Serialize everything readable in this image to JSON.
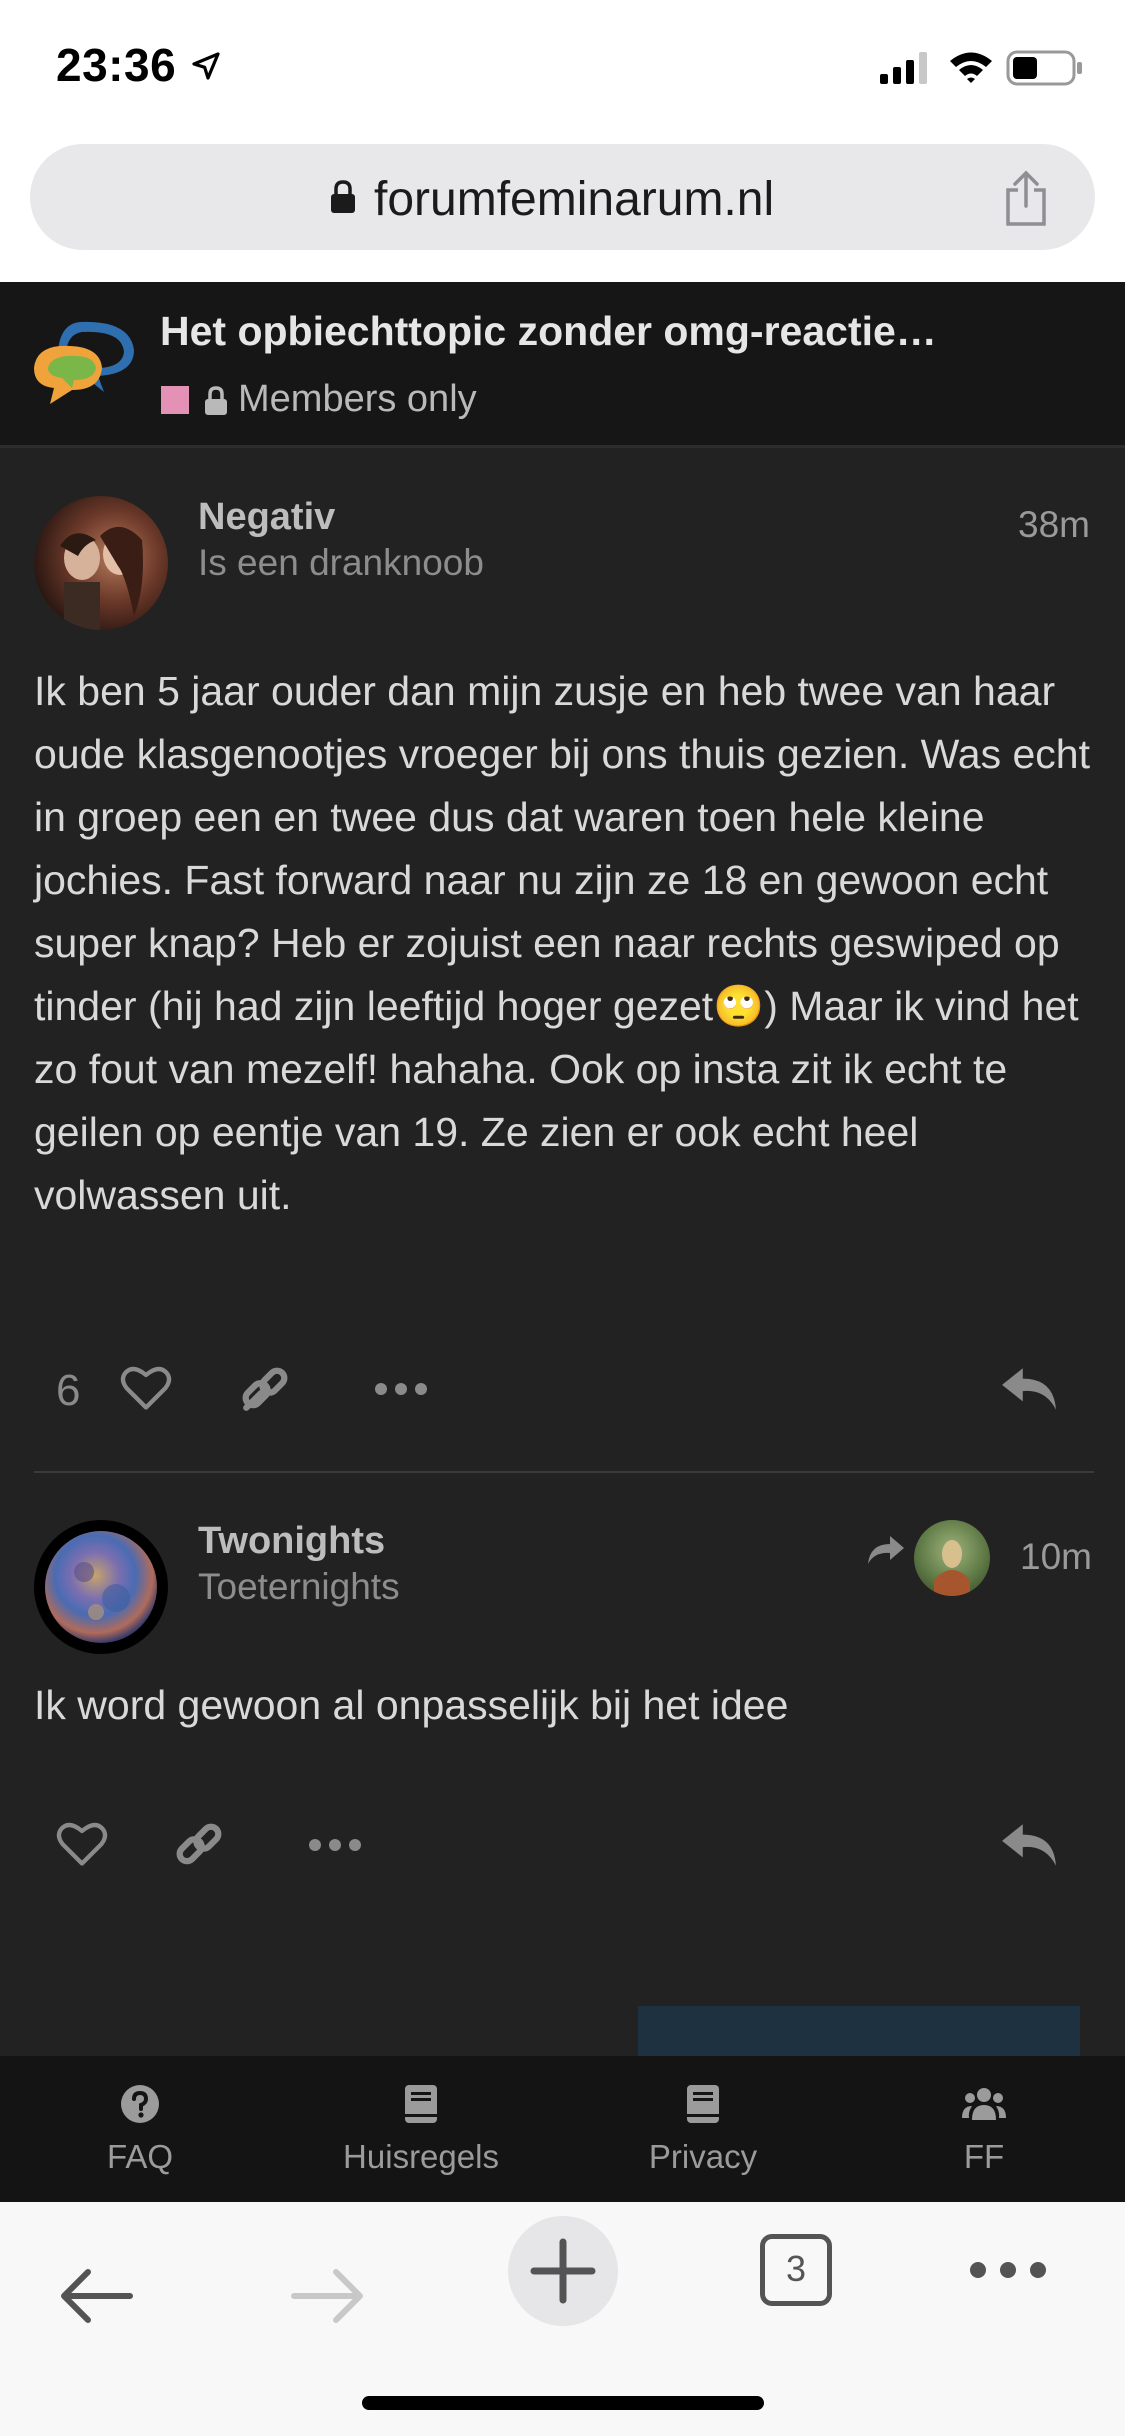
{
  "status_bar": {
    "time": "23:36"
  },
  "browser": {
    "url": "forumfeminarum.nl"
  },
  "topic": {
    "title": "Het opbiechttopic zonder omg-reactie…",
    "category": "Members only",
    "category_color": "#e391b4"
  },
  "posts": [
    {
      "username": "Negativ",
      "user_title": "Is een dranknoob",
      "time": "38m",
      "body": "Ik ben 5 jaar ouder dan mijn zusje en heb twee van haar oude klasgenootjes vroeger bij ons thuis gezien. Was echt in groep een en twee dus dat waren toen hele kleine jochies. Fast forward naar nu zijn ze 18 en gewoon echt super knap? Heb er zojuist een naar rechts geswiped op tinder (hij had zijn leeftijd hoger gezet🙄) Maar ik vind het zo fout van mezelf! hahaha. Ook op insta zit ik echt te geilen op eentje van 19. Ze zien er ook echt heel volwassen uit.",
      "likes": "6"
    },
    {
      "username": "Twonights",
      "user_title": "Toeternights",
      "time": "10m",
      "body": "Ik word gewoon al onpasselijk bij het idee"
    }
  ],
  "forum_nav": {
    "items": [
      {
        "label": "FAQ",
        "icon": "question-circle-icon"
      },
      {
        "label": "Huisregels",
        "icon": "book-icon"
      },
      {
        "label": "Privacy",
        "icon": "book-icon"
      },
      {
        "label": "FF",
        "icon": "users-icon"
      }
    ]
  },
  "safari_toolbar": {
    "tab_count": "3"
  }
}
